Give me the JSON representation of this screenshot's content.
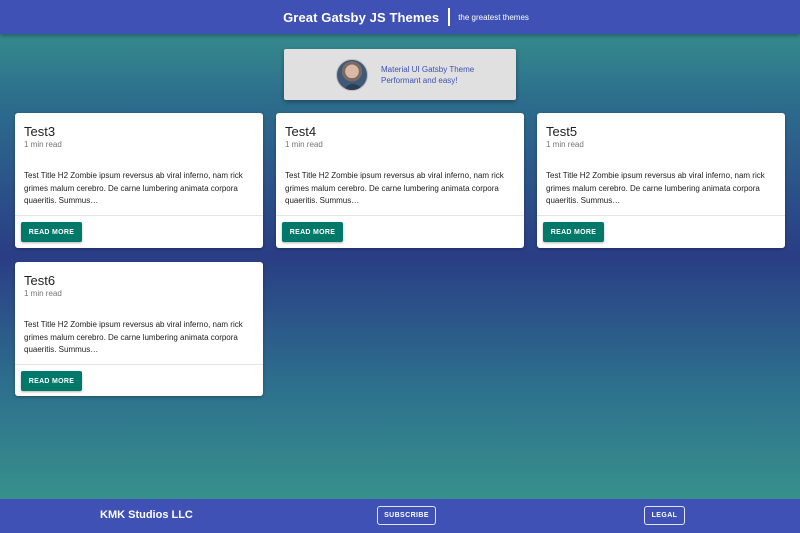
{
  "header": {
    "title": "Great Gatsby JS Themes",
    "tagline": "the greatest themes"
  },
  "author": {
    "line1": "Material UI Gatsby Theme",
    "line2": "Performant and easy!"
  },
  "posts": [
    {
      "title": "Test3",
      "read_time": "1 min read",
      "excerpt": "Test Title H2 Zombie ipsum reversus ab viral inferno, nam rick grimes malum cerebro. De carne lumbering animata corpora quaeritis. Summus…",
      "button": "READ MORE"
    },
    {
      "title": "Test4",
      "read_time": "1 min read",
      "excerpt": "Test Title H2 Zombie ipsum reversus ab viral inferno, nam rick grimes malum cerebro. De carne lumbering animata corpora quaeritis. Summus…",
      "button": "READ MORE"
    },
    {
      "title": "Test5",
      "read_time": "1 min read",
      "excerpt": "Test Title H2 Zombie ipsum reversus ab viral inferno, nam rick grimes malum cerebro. De carne lumbering animata corpora quaeritis. Summus…",
      "button": "READ MORE"
    },
    {
      "title": "Test6",
      "read_time": "1 min read",
      "excerpt": "Test Title H2 Zombie ipsum reversus ab viral inferno, nam rick grimes malum cerebro. De carne lumbering animata corpora quaeritis. Summus…",
      "button": "READ MORE"
    }
  ],
  "footer": {
    "company": "KMK Studios LLC",
    "subscribe": "SUBSCRIBE",
    "legal": "LEGAL"
  },
  "colors": {
    "primary": "#3f51b5",
    "button": "#00796b",
    "card": "#ffffff"
  },
  "icons": {
    "avatar": "author-avatar-photo"
  }
}
